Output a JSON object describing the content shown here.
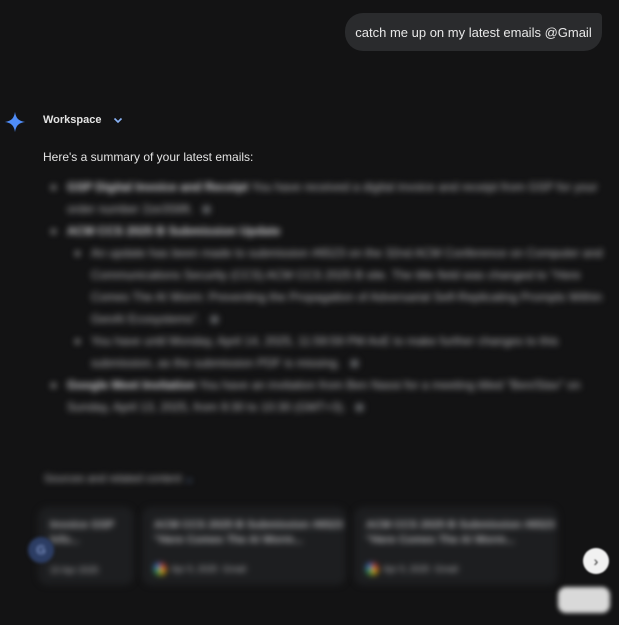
{
  "user_message": "catch me up on my latest emails @Gmail",
  "model_selector": {
    "label": "Workspace"
  },
  "intro": "Here's a summary of your latest emails:",
  "bullets": [
    {
      "title": "GSP Digital Invoice and Receipt",
      "text": "You have received a digital invoice and receipt from GSP for your order number 2ze3S6ft.",
      "level": 1
    },
    {
      "title": "ACM CCS 2025 B Submission Update",
      "text": "",
      "level": 1
    },
    {
      "title": "",
      "text": "An update has been made to submission #6523 on the 32nd ACM Conference on Computer and Communications Security (CCS) ACM CCS 2025 B site. The title field was changed to \"Here Comes The AI Worm: Preventing the Propagation of Adversarial Self-Replicating Prompts Within GenAI Ecosystems\".",
      "level": 2
    },
    {
      "title": "",
      "text": "You have until Monday, April 14, 2025, 11:59:59 PM AoE to make further changes to this submission, as the submission PDF is missing.",
      "level": 2
    },
    {
      "title": "Google Meet Invitation",
      "text": "You have an invitation from Ben Nassi for a meeting titled \"Ben/Stav\" on Sunday, April 13, 2025, from 9:30 to 10:30 (GMT+3).",
      "level": 1
    }
  ],
  "sources_label": "Sources and related content",
  "cards": [
    {
      "title": "Invoice GSP Info...",
      "date": "10 Apr 2025",
      "source": "Gmail"
    },
    {
      "title": "ACM CCS 2025 B Submission #6523 \"Here Comes The AI Worm...",
      "date": "Apr 9, 2025",
      "source": "Gmail"
    },
    {
      "title": "ACM CCS 2025 B Submission #6523 \"Here Comes The AI Worm...",
      "date": "Apr 9, 2025",
      "source": "Gmail"
    }
  ],
  "colors": {
    "background": "#131314",
    "bubble": "#2a2b2d",
    "card": "#1d1e20",
    "spark": "#4f8cf7"
  },
  "icons": [
    "gemini-spark-icon",
    "chevron-down-icon",
    "gmail-icon",
    "chevron-right-icon"
  ]
}
